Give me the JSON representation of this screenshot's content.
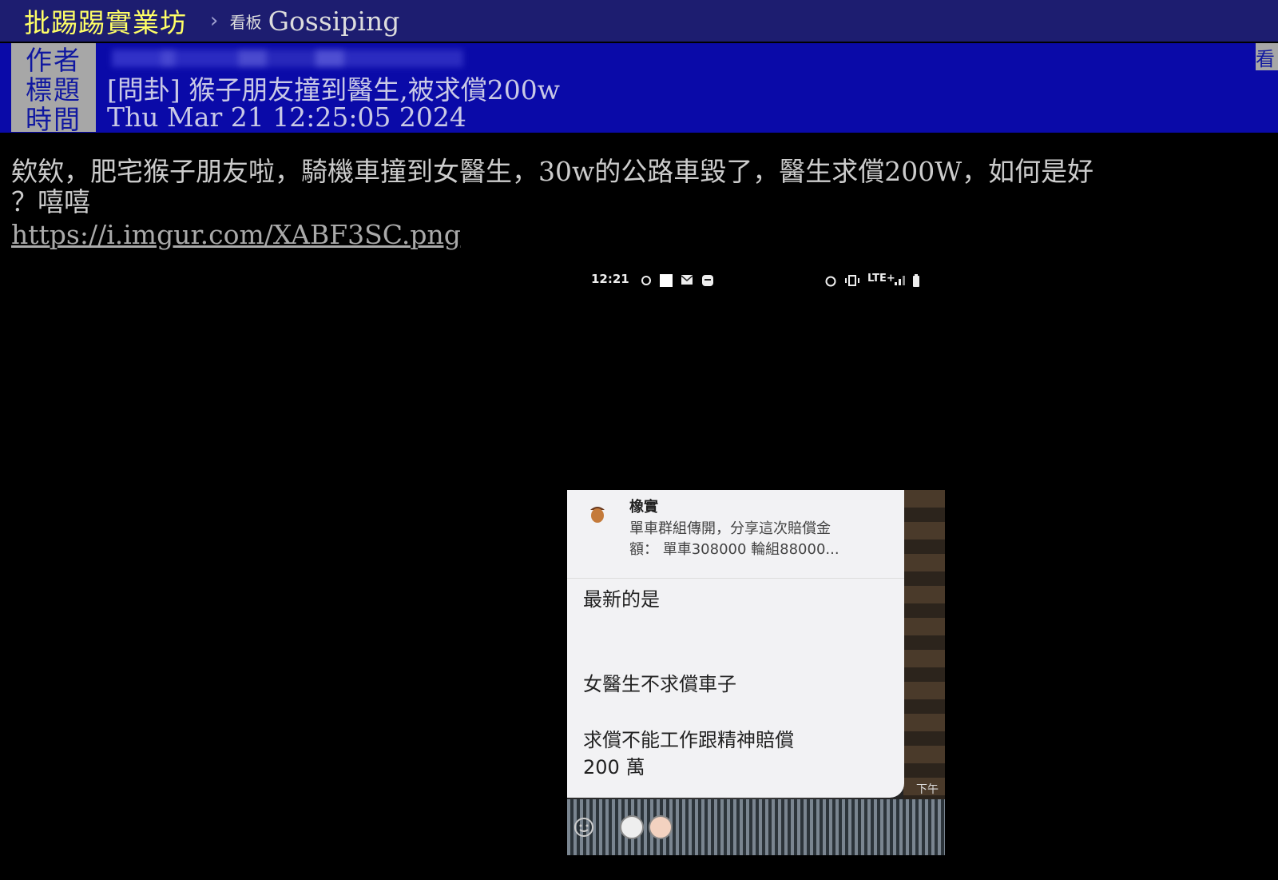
{
  "topbar": {
    "site_name": "批踢踢實業坊",
    "separator": "›",
    "board_prefix": "看板",
    "board_name": "Gossiping"
  },
  "meta": {
    "author_label": "作者",
    "title_label": "標題",
    "title_value": "[問卦] 猴子朋友撞到醫生,被求償200w",
    "time_label": "時間",
    "time_value": "Thu Mar 21 12:25:05 2024",
    "side_tab": "看"
  },
  "content": {
    "line1": "欸欸，肥宅猴子朋友啦，騎機車撞到女醫生，30w的公路車毀了，醫生求償200W，如何是好",
    "line2": "？嘻嘻",
    "link": "https://i.imgur.com/XABF3SC.png"
  },
  "screenshot": {
    "status_time": "12:21",
    "status_network": "LTE+",
    "notif_title": "橡實",
    "notif_body_line1": "單車群組傳開，分享這次賠償金",
    "notif_body_line2": "額： 單車308000 輪組88000...",
    "msg1": "最新的是",
    "msg2": "女醫生不求償車子",
    "msg3_line1": "求償不能工作跟精神賠償",
    "msg3_line2": "200 萬",
    "time_label": "下午"
  }
}
